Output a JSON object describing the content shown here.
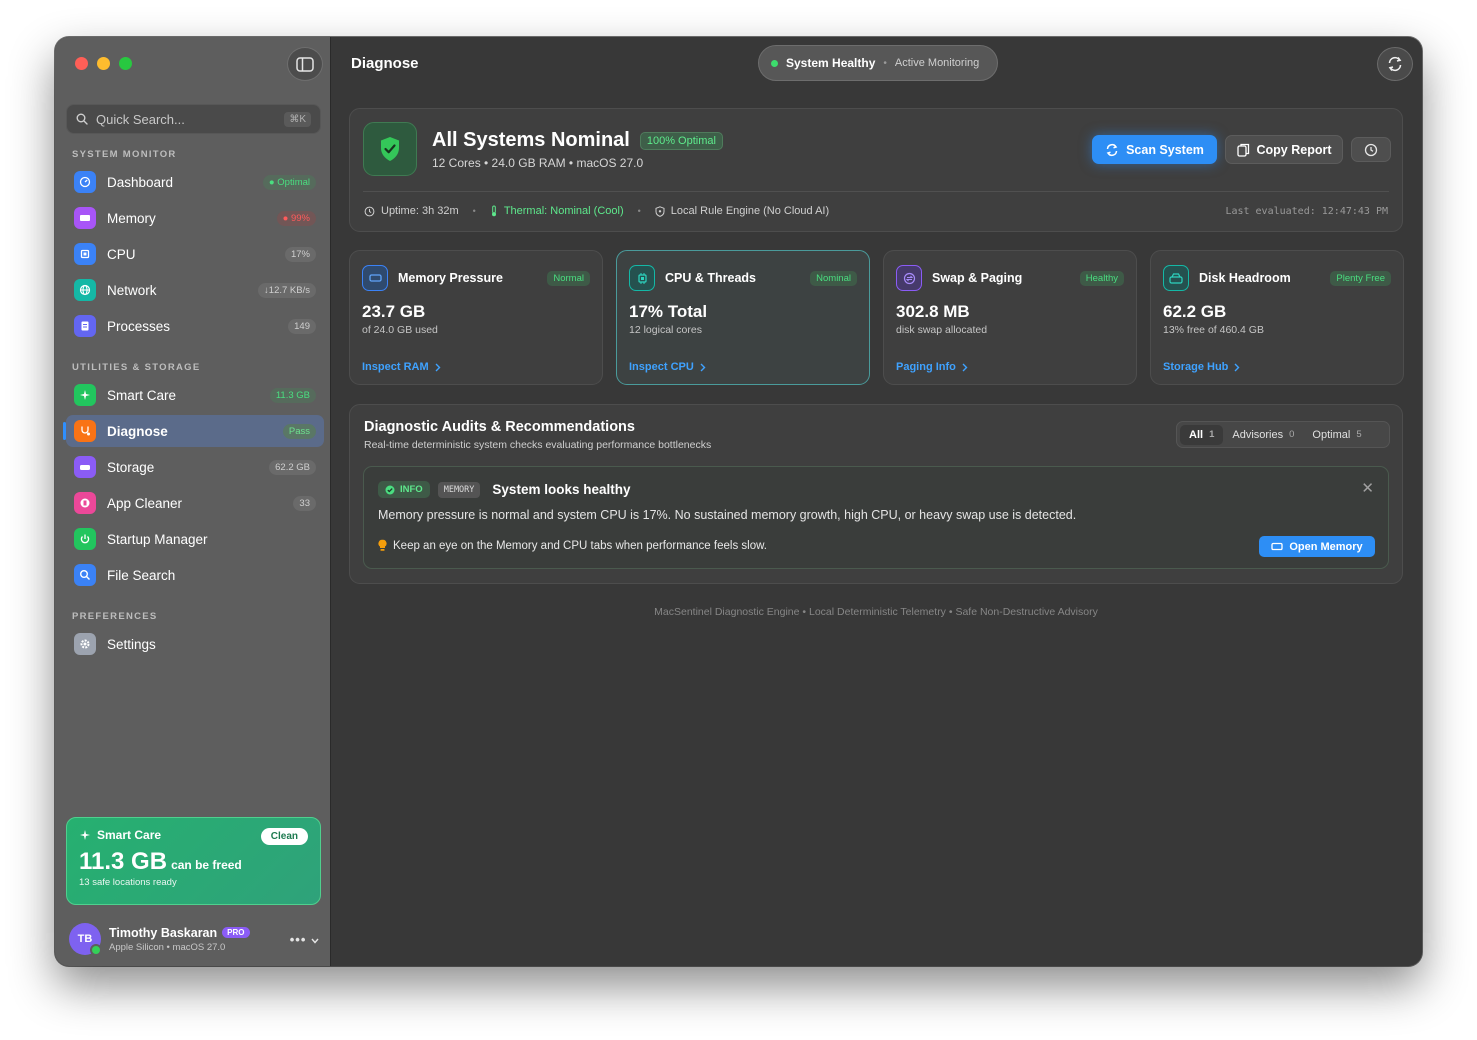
{
  "sidebar": {
    "search": {
      "placeholder": "Quick Search...",
      "shortcut": "⌘K"
    },
    "sections": {
      "monitor": "SYSTEM MONITOR",
      "utilities": "UTILITIES & STORAGE",
      "preferences": "PREFERENCES"
    },
    "items": [
      {
        "label": "Dashboard",
        "badge": "● Optimal",
        "icon": "gauge-icon",
        "color": "#3b82f6"
      },
      {
        "label": "Memory",
        "badge": "● 99%",
        "icon": "memory-icon",
        "color": "#a855f7"
      },
      {
        "label": "CPU",
        "badge": "17%",
        "icon": "cpu-icon",
        "color": "#3b82f6"
      },
      {
        "label": "Network",
        "badge": "↓12.7 KB/s",
        "icon": "globe-icon",
        "color": "#14b8a6"
      },
      {
        "label": "Processes",
        "badge": "149",
        "icon": "list-icon",
        "color": "#6366f1"
      },
      {
        "label": "Smart Care",
        "badge": "11.3 GB",
        "icon": "sparkle-icon",
        "color": "#22c55e"
      },
      {
        "label": "Diagnose",
        "badge": "Pass",
        "icon": "stethoscope-icon",
        "color": "#f97316"
      },
      {
        "label": "Storage",
        "badge": "62.2 GB",
        "icon": "drive-icon",
        "color": "#8b5cf6"
      },
      {
        "label": "App Cleaner",
        "badge": "33",
        "icon": "trash-icon",
        "color": "#ec4899"
      },
      {
        "label": "Startup Manager",
        "badge": "",
        "icon": "power-icon",
        "color": "#22c55e"
      },
      {
        "label": "File Search",
        "badge": "",
        "icon": "magnifier-icon",
        "color": "#3b82f6"
      },
      {
        "label": "Settings",
        "badge": "",
        "icon": "gear-icon",
        "color": "#9ca3af"
      }
    ],
    "smart_care": {
      "title": "Smart Care",
      "pill": "Clean",
      "value": "11.3 GB",
      "value_suffix": "can be freed",
      "sub": "13 safe locations ready"
    },
    "user": {
      "initials": "TB",
      "name": "Timothy Baskaran",
      "badge": "PRO",
      "sub": "Apple Silicon • macOS 27.0",
      "more": "•••"
    }
  },
  "header": {
    "title": "Diagnose",
    "status_main": "System Healthy",
    "status_sep": "•",
    "status_sub": "Active Monitoring"
  },
  "hero": {
    "title": "All Systems Nominal",
    "badge": "100% Optimal",
    "sub": "12 Cores • 24.0 GB RAM • macOS 27.0",
    "scan_label": "Scan System",
    "copy_label": "Copy Report",
    "uptime": "Uptime: 3h 32m",
    "thermal": "Thermal: Nominal (Cool)",
    "engine": "Local Rule Engine (No Cloud AI)",
    "last_evaluated": "Last evaluated: 12:47:43 PM",
    "sep": "•"
  },
  "cards": [
    {
      "title": "Memory Pressure",
      "badge": "Normal",
      "value": "23.7 GB",
      "sub": "of 24.0 GB used",
      "link": "Inspect RAM",
      "accent": "#3b82f6"
    },
    {
      "title": "CPU & Threads",
      "badge": "Nominal",
      "value": "17% Total",
      "sub": "12 logical cores",
      "link": "Inspect CPU",
      "accent": "#14b8a6"
    },
    {
      "title": "Swap & Paging",
      "badge": "Healthy",
      "value": "302.8 MB",
      "sub": "disk swap allocated",
      "link": "Paging Info",
      "accent": "#8b5cf6"
    },
    {
      "title": "Disk Headroom",
      "badge": "Plenty Free",
      "value": "62.2 GB",
      "sub": "13% free of 460.4 GB",
      "link": "Storage Hub",
      "accent": "#14b8a6"
    }
  ],
  "audits": {
    "title": "Diagnostic Audits & Recommendations",
    "sub": "Real-time deterministic system checks evaluating performance bottlenecks",
    "filters": [
      {
        "label": "All",
        "count": "1"
      },
      {
        "label": "Advisories",
        "count": "0"
      },
      {
        "label": "Optimal",
        "count": "5"
      }
    ],
    "item": {
      "level": "INFO",
      "category": "MEMORY",
      "title": "System looks healthy",
      "body": "Memory pressure is normal and system CPU is 17%. No sustained memory growth, high CPU, or heavy swap use is detected.",
      "tip": "Keep an eye on the Memory and CPU tabs when performance feels slow.",
      "action": "Open Memory",
      "close": "✕"
    }
  },
  "footer": "MacSentinel Diagnostic Engine • Local Deterministic Telemetry • Safe Non-Destructive Advisory",
  "colors": {
    "accent": "#2d8ef5",
    "healthy": "#3ddc6d",
    "smart_care": "#26b070"
  }
}
